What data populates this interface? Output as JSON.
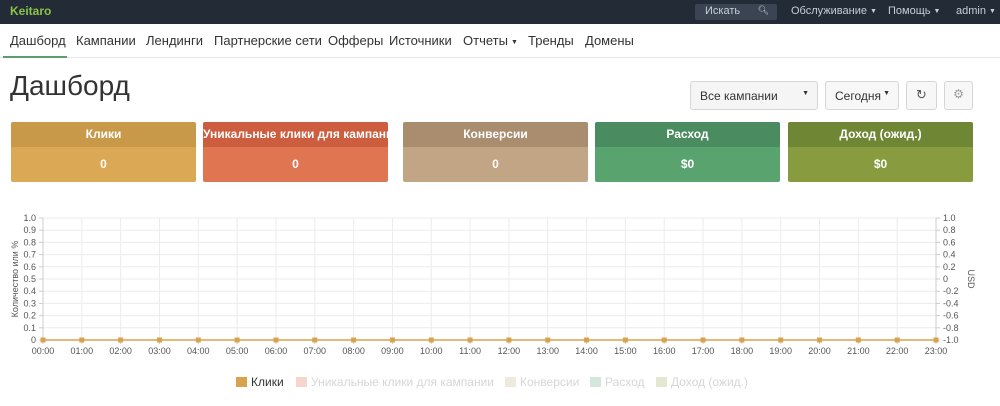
{
  "topbar": {
    "brand": "Keitaro",
    "search_placeholder": "Искать",
    "menu": {
      "service": "Обслуживание",
      "help": "Помощь",
      "user": "admin"
    }
  },
  "nav": {
    "items": [
      "Дашборд",
      "Кампании",
      "Лендинги",
      "Партнерские сети",
      "Офферы",
      "Источники",
      "Отчеты",
      "Тренды",
      "Домены"
    ],
    "active": "Дашборд"
  },
  "page": {
    "title": "Дашборд",
    "campaign_select": "Все кампании",
    "period": "Сегодня"
  },
  "cards": [
    {
      "title": "Клики",
      "value": "0",
      "header_color": "#c9994a",
      "body_color": "#dba955"
    },
    {
      "title": "Уникальные клики для кампании",
      "value": "0",
      "header_color": "#cc5d3e",
      "body_color": "#e07552"
    },
    {
      "title": "Конверсии",
      "value": "0",
      "header_color": "#a98d6e",
      "body_color": "#c2a585"
    },
    {
      "title": "Расход",
      "value": "$0",
      "header_color": "#4a8c5f",
      "body_color": "#59a36e"
    },
    {
      "title": "Доход (ожид.)",
      "value": "$0",
      "header_color": "#6f8634",
      "body_color": "#889c3f"
    }
  ],
  "chart_data": {
    "type": "line",
    "x": [
      "00:00",
      "01:00",
      "02:00",
      "03:00",
      "04:00",
      "05:00",
      "06:00",
      "07:00",
      "08:00",
      "09:00",
      "10:00",
      "11:00",
      "12:00",
      "13:00",
      "14:00",
      "15:00",
      "16:00",
      "17:00",
      "18:00",
      "19:00",
      "20:00",
      "21:00",
      "22:00",
      "23:00"
    ],
    "y_left_label": "Количество или %",
    "y_right_label": "USD",
    "y_left_ticks": [
      "0",
      "0.1",
      "0.2",
      "0.3",
      "0.4",
      "0.5",
      "0.6",
      "0.7",
      "0.8",
      "0.9",
      "1.0"
    ],
    "y_right_ticks": [
      "-1.0",
      "-0.8",
      "-0.6",
      "-0.4",
      "-0.2",
      "0",
      "0.2",
      "0.4",
      "0.6",
      "0.8",
      "1.0"
    ],
    "ylim_left": [
      0,
      1
    ],
    "ylim_right": [
      -1,
      1
    ],
    "grid": true,
    "legend_position": "bottom",
    "series": [
      {
        "name": "Клики",
        "color": "#d9a24e",
        "active": true,
        "values": [
          0,
          0,
          0,
          0,
          0,
          0,
          0,
          0,
          0,
          0,
          0,
          0,
          0,
          0,
          0,
          0,
          0,
          0,
          0,
          0,
          0,
          0,
          0,
          0
        ]
      },
      {
        "name": "Уникальные клики для кампании",
        "color": "#f6d5cc",
        "active": false,
        "values": []
      },
      {
        "name": "Конверсии",
        "color": "#efeadc",
        "active": false,
        "values": []
      },
      {
        "name": "Расход",
        "color": "#d3e8da",
        "active": false,
        "values": []
      },
      {
        "name": "Доход (ожид.)",
        "color": "#e3e8d3",
        "active": false,
        "values": []
      }
    ]
  }
}
